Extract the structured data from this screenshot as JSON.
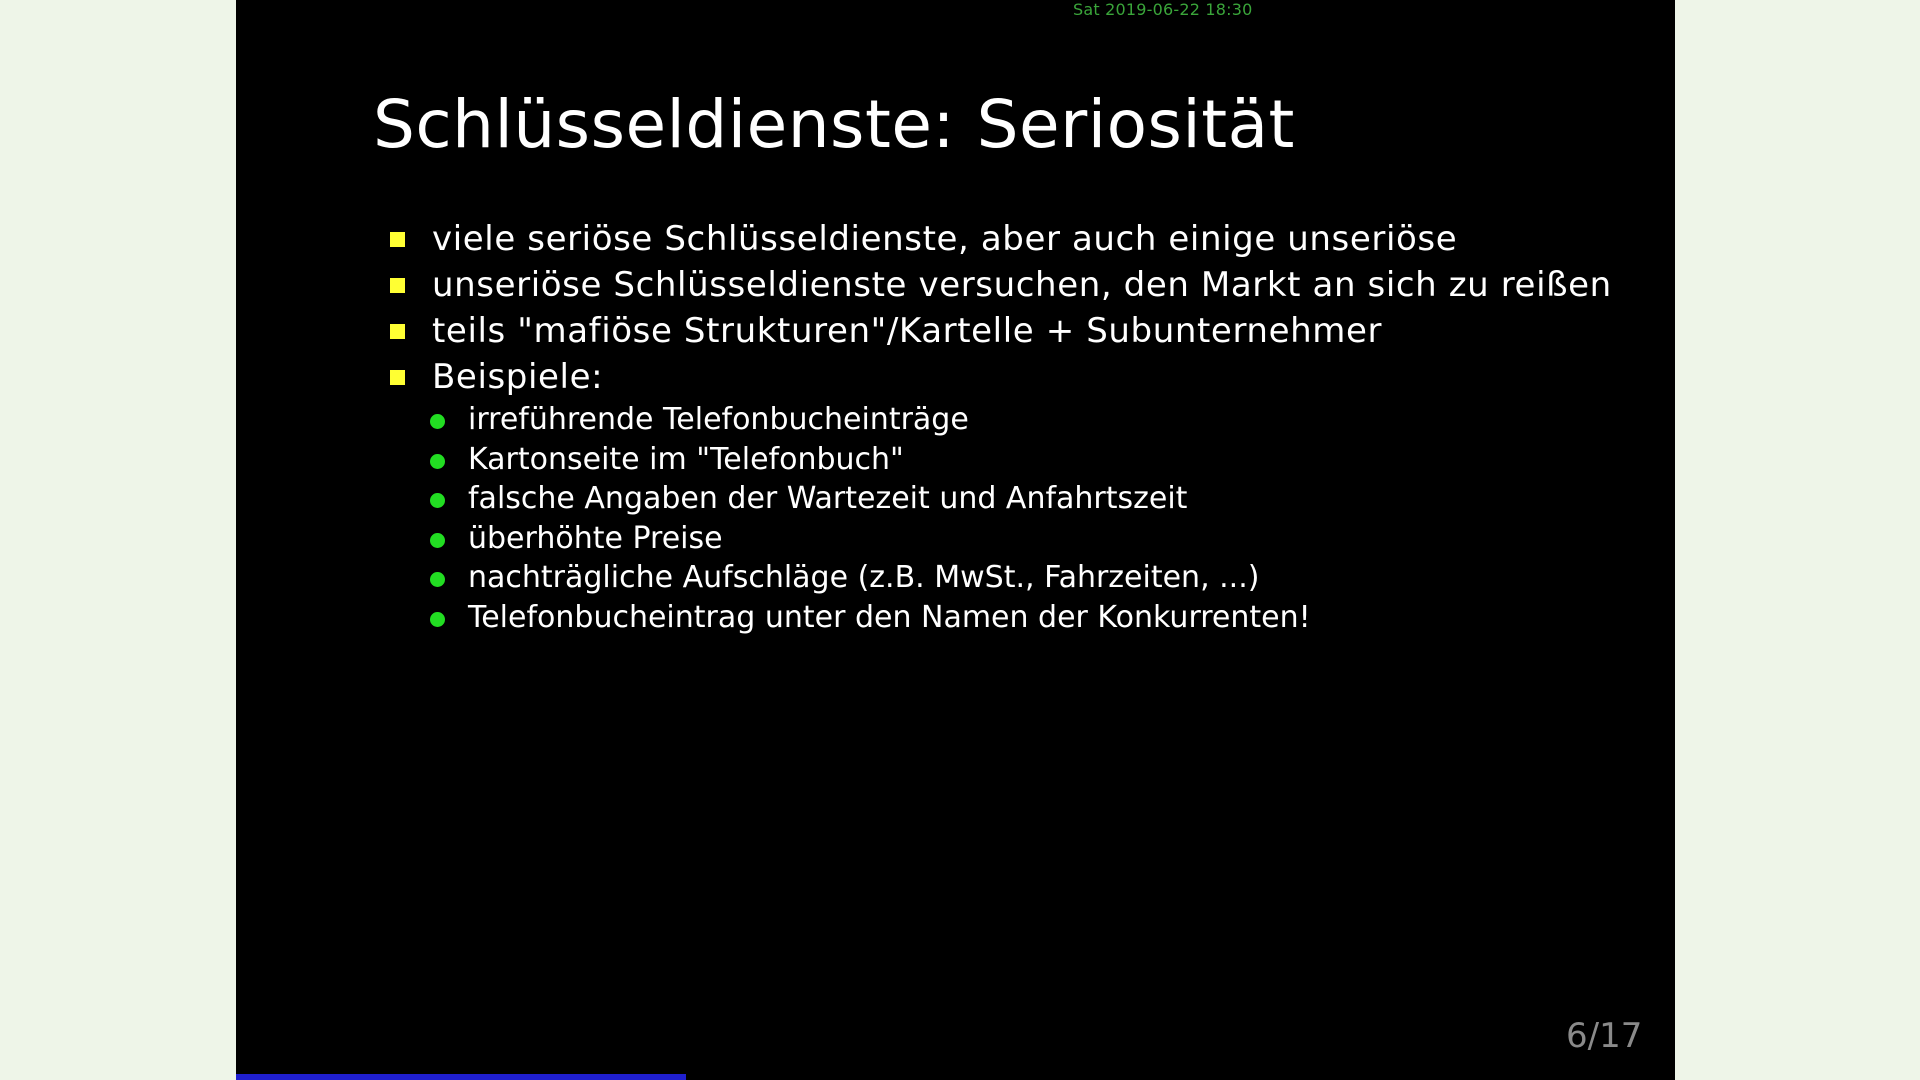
{
  "clock": "Sat 2019-06-22 18:30",
  "title": "Schlüsseldienste: Seriosität",
  "bullets": [
    "viele seriöse Schlüsseldienste, aber auch einige unseriöse",
    "unseriöse Schlüsseldienste versuchen, den Markt an sich zu reißen",
    "teils \"mafiöse Strukturen\"/Kartelle + Subunternehmer",
    "Beispiele:"
  ],
  "examples": [
    "irreführende Telefonbucheinträge",
    "Kartonseite im \"Telefonbuch\"",
    "falsche Angaben der Wartezeit und Anfahrtszeit",
    "überhöhte Preise",
    "nachträgliche Aufschläge (z.B. MwSt., Fahrzeiten, ...)",
    "Telefonbucheintrag unter den Namen der Konkurrenten!"
  ],
  "page_number": "6/17",
  "progress_fraction": 0.3125,
  "colors": {
    "bullet_square": "#ffff33",
    "bullet_dot": "#22dd22",
    "progress": "#1f1fcf",
    "clock": "#3aa53a"
  }
}
